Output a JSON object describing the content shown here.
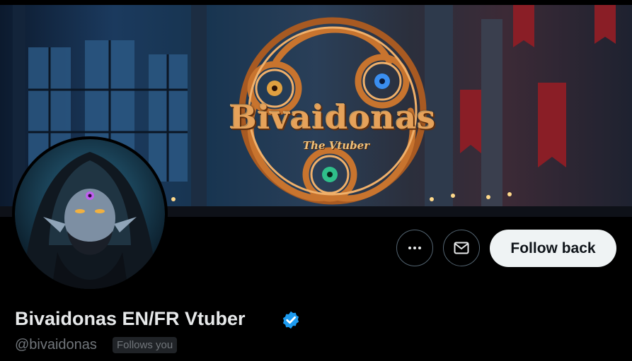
{
  "banner": {
    "logo_title": "Bivaidonas",
    "logo_subtitle": "The Vtuber"
  },
  "profile": {
    "display_name": "Bivaidonas EN/FR Vtuber",
    "handle": "@bivaidonas",
    "follows_you_label": "Follows you",
    "verified": true
  },
  "actions": {
    "follow_label": "Follow back"
  },
  "icons": {
    "more": "more-horizontal-icon",
    "message": "envelope-icon",
    "verified": "verified-badge-icon"
  },
  "colors": {
    "background": "#000000",
    "verified_blue": "#1d9bf0",
    "follow_button_bg": "#eff3f4",
    "muted_text": "#71767b"
  }
}
